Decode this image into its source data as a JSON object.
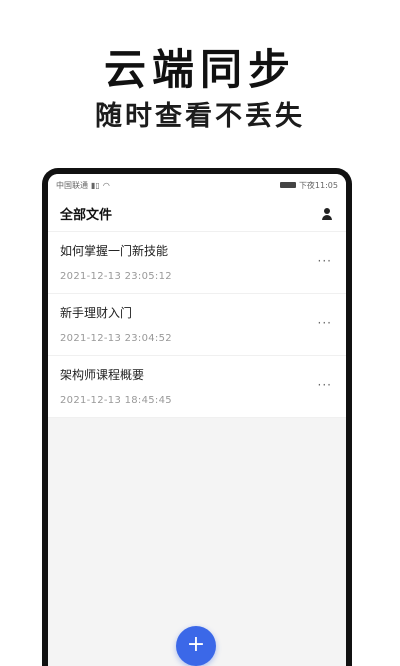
{
  "promo": {
    "title": "云端同步",
    "subtitle": "随时查看不丢失"
  },
  "statusbar": {
    "carrier": "中国联通",
    "signal": "ⁿᵢᵢ",
    "time": "下夜11:05"
  },
  "appbar": {
    "title": "全部文件",
    "user_icon": "user-icon"
  },
  "files": [
    {
      "title": "如何掌握一门新技能",
      "time": "2021-12-13 23:05:12",
      "more": "···"
    },
    {
      "title": "新手理财入门",
      "time": "2021-12-13 23:04:52",
      "more": "···"
    },
    {
      "title": "架构师课程概要",
      "time": "2021-12-13 18:45:45",
      "more": "···"
    }
  ],
  "fab": {
    "label": "+"
  },
  "colors": {
    "accent": "#3b68e8"
  }
}
